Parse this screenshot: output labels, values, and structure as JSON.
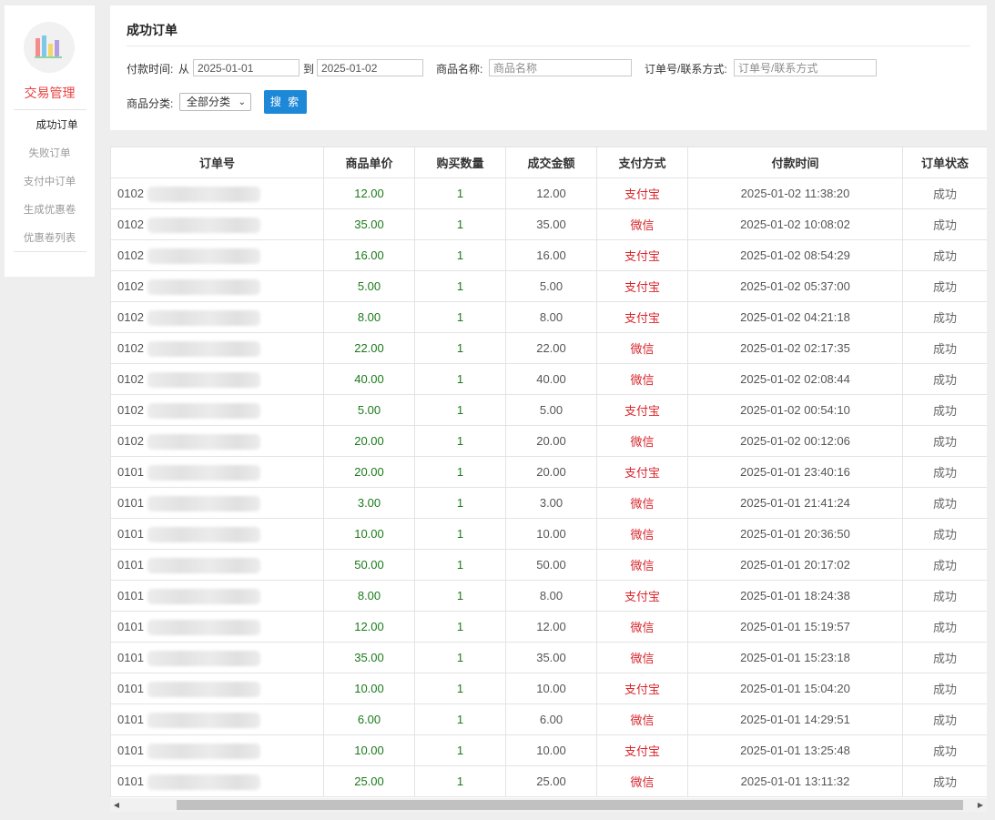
{
  "sidebar": {
    "title": "交易管理",
    "items": [
      {
        "label": "成功订单"
      },
      {
        "label": "失败订单"
      },
      {
        "label": "支付中订单"
      },
      {
        "label": "生成优惠卷"
      },
      {
        "label": "优惠卷列表"
      }
    ]
  },
  "panel": {
    "title": "成功订单",
    "pay_time_label": "付款时间:",
    "from_label": "从",
    "date_from": "2025-01-01",
    "to_label": "到",
    "date_to": "2025-01-02",
    "product_name_label": "商品名称:",
    "product_name_placeholder": "商品名称",
    "order_contact_label": "订单号/联系方式:",
    "order_contact_placeholder": "订单号/联系方式",
    "category_label": "商品分类:",
    "category_selected": "全部分类",
    "search_button": "搜 索"
  },
  "table": {
    "headers": [
      "订单号",
      "商品单价",
      "购买数量",
      "成交金额",
      "支付方式",
      "付款时间",
      "订单状态"
    ],
    "rows": [
      {
        "order": "0102",
        "price": "12.00",
        "qty": "1",
        "amount": "12.00",
        "pay": "支付宝",
        "time": "2025-01-02 11:38:20",
        "status": "成功"
      },
      {
        "order": "0102",
        "price": "35.00",
        "qty": "1",
        "amount": "35.00",
        "pay": "微信",
        "time": "2025-01-02 10:08:02",
        "status": "成功"
      },
      {
        "order": "0102",
        "price": "16.00",
        "qty": "1",
        "amount": "16.00",
        "pay": "支付宝",
        "time": "2025-01-02 08:54:29",
        "status": "成功"
      },
      {
        "order": "0102",
        "price": "5.00",
        "qty": "1",
        "amount": "5.00",
        "pay": "支付宝",
        "time": "2025-01-02 05:37:00",
        "status": "成功"
      },
      {
        "order": "0102",
        "price": "8.00",
        "qty": "1",
        "amount": "8.00",
        "pay": "支付宝",
        "time": "2025-01-02 04:21:18",
        "status": "成功"
      },
      {
        "order": "0102",
        "price": "22.00",
        "qty": "1",
        "amount": "22.00",
        "pay": "微信",
        "time": "2025-01-02 02:17:35",
        "status": "成功"
      },
      {
        "order": "0102",
        "price": "40.00",
        "qty": "1",
        "amount": "40.00",
        "pay": "微信",
        "time": "2025-01-02 02:08:44",
        "status": "成功"
      },
      {
        "order": "0102",
        "price": "5.00",
        "qty": "1",
        "amount": "5.00",
        "pay": "支付宝",
        "time": "2025-01-02 00:54:10",
        "status": "成功"
      },
      {
        "order": "0102",
        "price": "20.00",
        "qty": "1",
        "amount": "20.00",
        "pay": "微信",
        "time": "2025-01-02 00:12:06",
        "status": "成功"
      },
      {
        "order": "0101",
        "price": "20.00",
        "qty": "1",
        "amount": "20.00",
        "pay": "支付宝",
        "time": "2025-01-01 23:40:16",
        "status": "成功"
      },
      {
        "order": "0101",
        "price": "3.00",
        "qty": "1",
        "amount": "3.00",
        "pay": "微信",
        "time": "2025-01-01 21:41:24",
        "status": "成功"
      },
      {
        "order": "0101",
        "price": "10.00",
        "qty": "1",
        "amount": "10.00",
        "pay": "微信",
        "time": "2025-01-01 20:36:50",
        "status": "成功"
      },
      {
        "order": "0101",
        "price": "50.00",
        "qty": "1",
        "amount": "50.00",
        "pay": "微信",
        "time": "2025-01-01 20:17:02",
        "status": "成功"
      },
      {
        "order": "0101",
        "price": "8.00",
        "qty": "1",
        "amount": "8.00",
        "pay": "支付宝",
        "time": "2025-01-01 18:24:38",
        "status": "成功"
      },
      {
        "order": "0101",
        "price": "12.00",
        "qty": "1",
        "amount": "12.00",
        "pay": "微信",
        "time": "2025-01-01 15:19:57",
        "status": "成功"
      },
      {
        "order": "0101",
        "price": "35.00",
        "qty": "1",
        "amount": "35.00",
        "pay": "微信",
        "time": "2025-01-01 15:23:18",
        "status": "成功"
      },
      {
        "order": "0101",
        "price": "10.00",
        "qty": "1",
        "amount": "10.00",
        "pay": "支付宝",
        "time": "2025-01-01 15:04:20",
        "status": "成功"
      },
      {
        "order": "0101",
        "price": "6.00",
        "qty": "1",
        "amount": "6.00",
        "pay": "微信",
        "time": "2025-01-01 14:29:51",
        "status": "成功"
      },
      {
        "order": "0101",
        "price": "10.00",
        "qty": "1",
        "amount": "10.00",
        "pay": "支付宝",
        "time": "2025-01-01 13:25:48",
        "status": "成功"
      },
      {
        "order": "0101",
        "price": "25.00",
        "qty": "1",
        "amount": "25.00",
        "pay": "微信",
        "time": "2025-01-01 13:11:32",
        "status": "成功"
      }
    ]
  },
  "colors": {
    "accent_red": "#e84343",
    "button_blue": "#1e88d8",
    "price_green": "#1b7a1b",
    "pay_red": "#d9262c"
  },
  "icons": {
    "logo": "bar-chart-icon",
    "scroll_left": "scroll-left-arrow-icon",
    "scroll_right": "scroll-right-arrow-icon"
  }
}
